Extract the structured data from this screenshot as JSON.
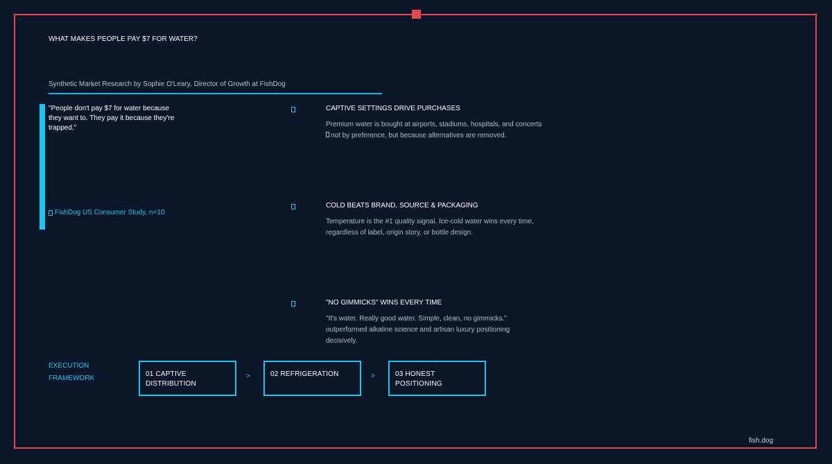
{
  "header": {
    "title": "WHAT MAKES PEOPLE PAY $7 FOR WATER?",
    "subtitle": "Synthetic Market Research by Sophie O'Leary, Director of Growth at FishDog"
  },
  "quote": {
    "text": "\"People don't pay $7 for water because they want to. They pay it because they're trapped.\"",
    "source": "FishDog US Consumer Study, n=10"
  },
  "findings": [
    {
      "title": "CAPTIVE SETTINGS DRIVE PURCHASES",
      "body_line1": "Premium water is bought at airports, stadiums, hospitals, and concerts",
      "body_line2": "not by preference, but because alternatives are removed."
    },
    {
      "title": "COLD BEATS BRAND, SOURCE & PACKAGING",
      "body": "Temperature is the #1 quality signal. Ice-cold water wins every time, regardless of label, origin story, or bottle design."
    },
    {
      "title": "\"NO GIMMICKS\" WINS EVERY TIME",
      "body": "\"It's water. Really good water. Simple, clean, no gimmicks.\" outperformed alkaline science and artisan luxury positioning decisively."
    }
  ],
  "framework": {
    "label_line1": "EXECUTION",
    "label_line2": "FRAMEWORK",
    "steps": [
      {
        "label": "01  CAPTIVE DISTRIBUTION"
      },
      {
        "label": "02  REFRIGERATION"
      },
      {
        "label": "03  HONEST POSITIONING"
      }
    ],
    "separator": ">"
  },
  "footer": {
    "brand": "fish.dog"
  },
  "colors": {
    "background": "#0b1628",
    "frame": "#e5484d",
    "accent": "#22c4ef",
    "text": "#ffffff",
    "muted": "#b0bac9"
  }
}
